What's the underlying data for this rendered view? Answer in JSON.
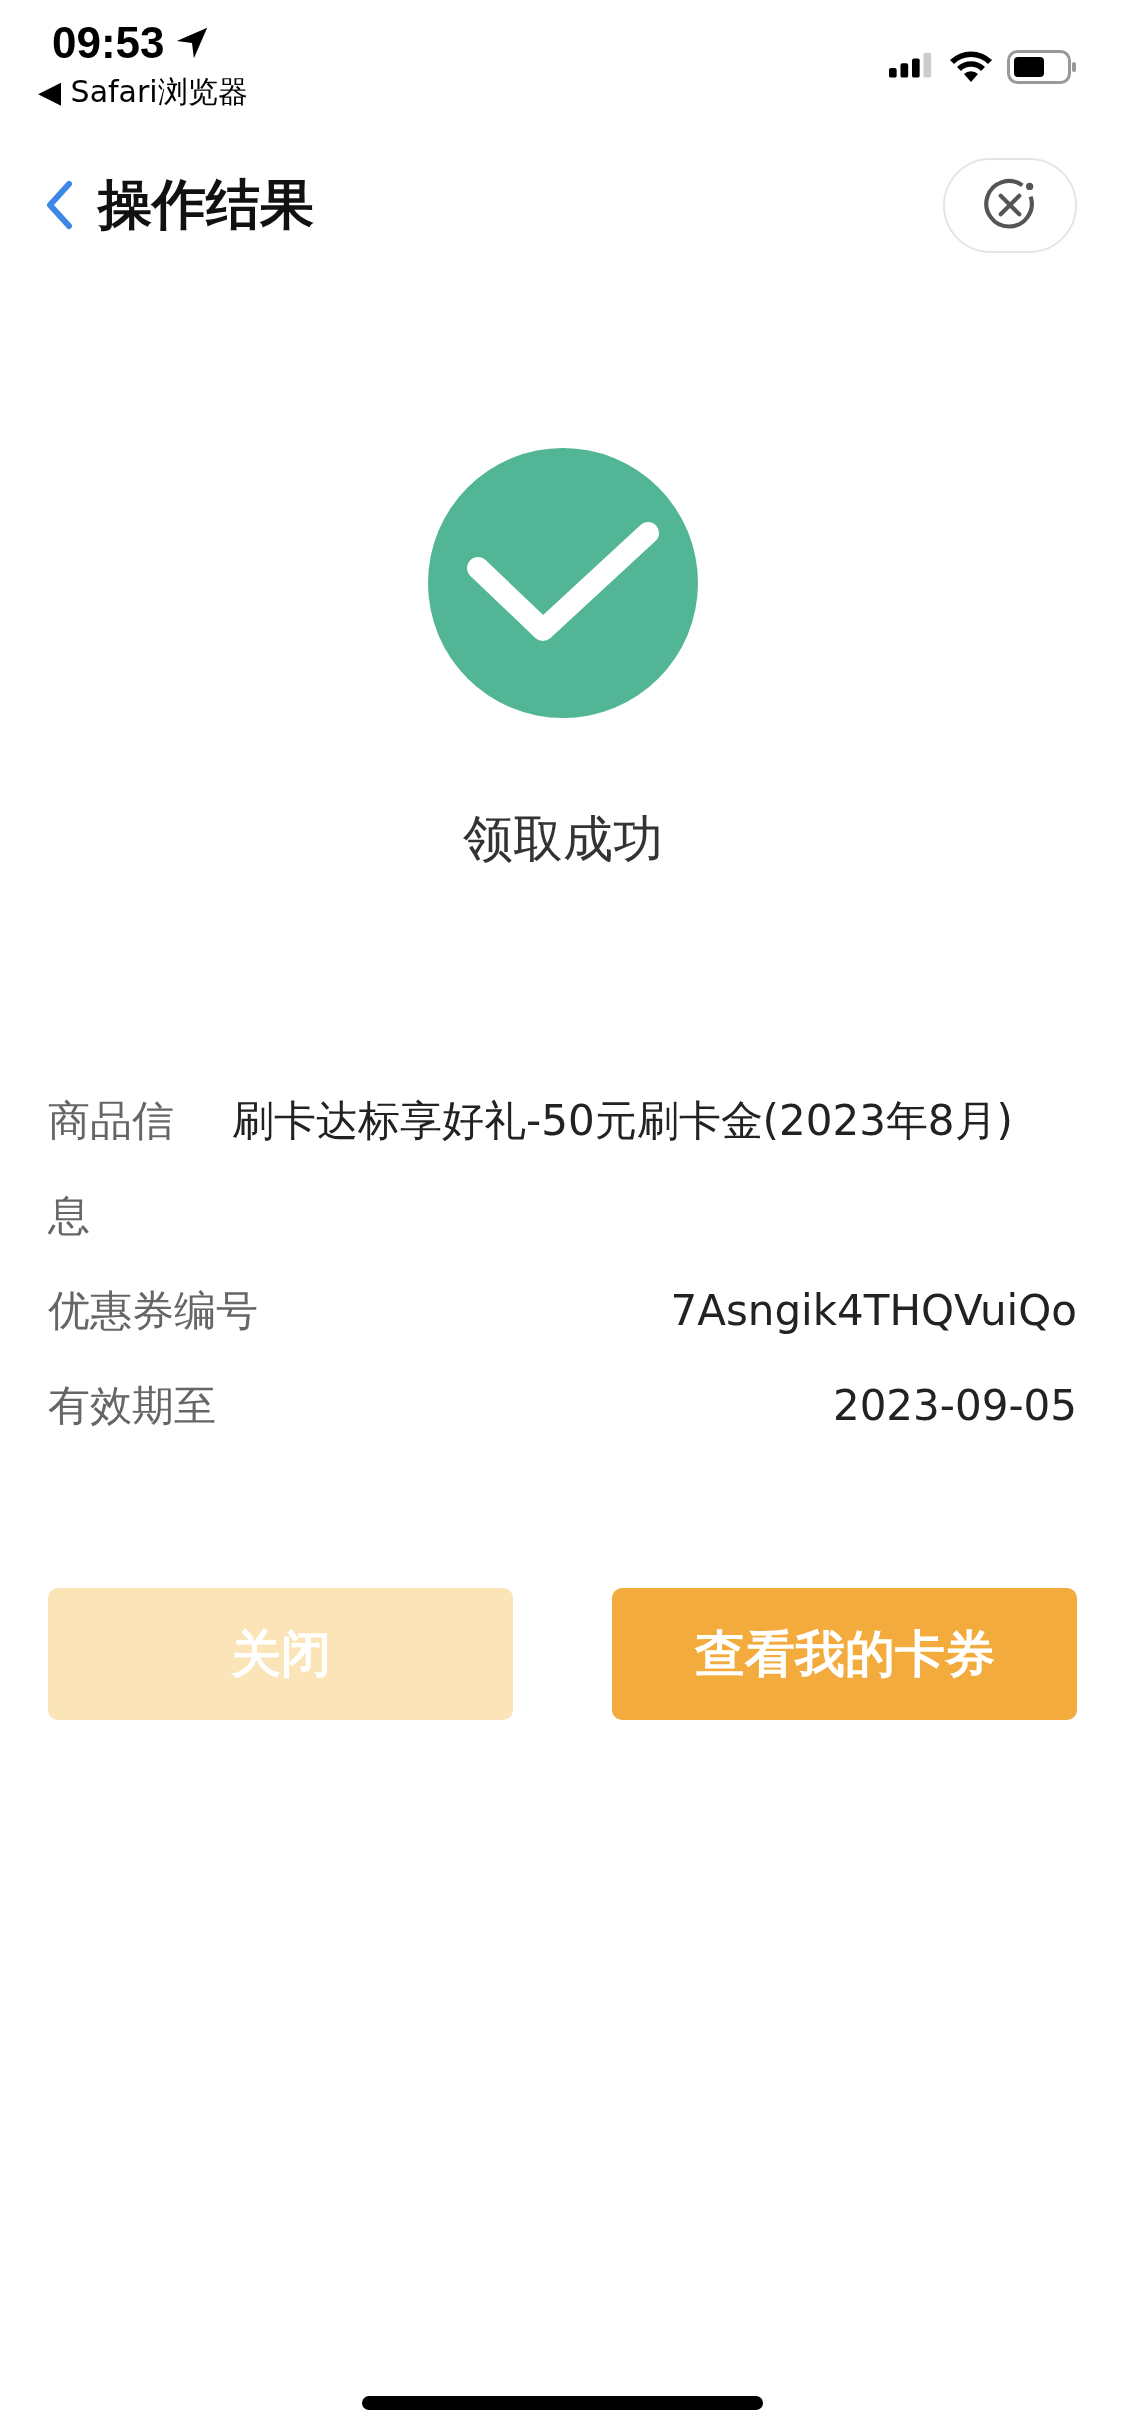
{
  "status_bar": {
    "time": "09:53",
    "back_app": "◀ Safari浏览器"
  },
  "nav": {
    "title": "操作结果"
  },
  "result": {
    "message": "领取成功"
  },
  "details": [
    {
      "label": "商品信息",
      "value": "刷卡达标享好礼-50元刷卡金(2023年8月)",
      "kind": "wrap"
    },
    {
      "label": "优惠券编号",
      "value": "7Asngik4THQVuiQo",
      "kind": "right"
    },
    {
      "label": "有效期至",
      "value": "2023-09-05",
      "kind": "right"
    }
  ],
  "buttons": [
    {
      "label": "关闭",
      "disabled": true
    },
    {
      "label": "查看我的卡券",
      "disabled": false
    }
  ]
}
